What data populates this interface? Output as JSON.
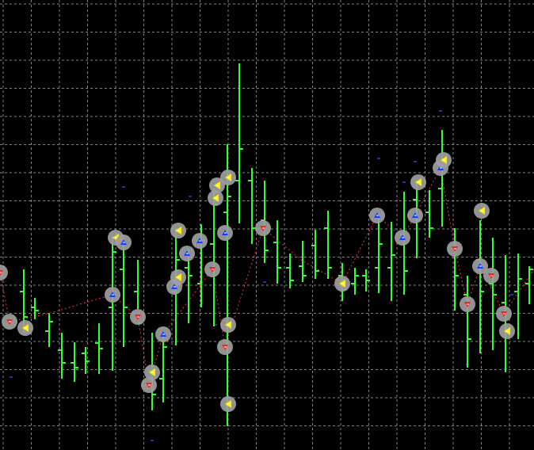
{
  "chart_data": {
    "type": "ohlc",
    "title": "",
    "xlabel": "",
    "ylabel": "",
    "grid": true,
    "ylim": [
      0,
      568
    ],
    "colors": {
      "background": "#000000",
      "grid": "#9a9a9a",
      "bar": "#33ff33",
      "arrow_up": "#1a3cff",
      "arrow_down": "#ff2020",
      "marker_yellow": "#ffee00",
      "marker_halo": "#9e9e9e",
      "dashed_line": "#ff3030",
      "dot": "#2233aa"
    },
    "bars": [
      {
        "x": 30,
        "high": 228,
        "low": 148,
        "open": 200,
        "close": 168
      },
      {
        "x": 44,
        "high": 192,
        "low": 165,
        "open": 180,
        "close": 176
      },
      {
        "x": 62,
        "high": 172,
        "low": 130,
        "open": 150,
        "close": 162
      },
      {
        "x": 78,
        "high": 148,
        "low": 90,
        "open": 126,
        "close": 110
      },
      {
        "x": 94,
        "high": 136,
        "low": 86,
        "open": 110,
        "close": 104
      },
      {
        "x": 108,
        "high": 130,
        "low": 96,
        "open": 122,
        "close": 112
      },
      {
        "x": 125,
        "high": 160,
        "low": 96,
        "open": 135,
        "close": 128
      },
      {
        "x": 142,
        "high": 270,
        "low": 100,
        "open": 180,
        "close": 250
      },
      {
        "x": 156,
        "high": 265,
        "low": 130,
        "open": 228,
        "close": 180
      },
      {
        "x": 174,
        "high": 240,
        "low": 178,
        "open": 200,
        "close": 160
      },
      {
        "x": 192,
        "high": 148,
        "low": 50,
        "open": 100,
        "close": 70
      },
      {
        "x": 206,
        "high": 148,
        "low": 60,
        "open": 90,
        "close": 130
      },
      {
        "x": 222,
        "high": 280,
        "low": 132,
        "open": 200,
        "close": 240
      },
      {
        "x": 238,
        "high": 254,
        "low": 160,
        "open": 230,
        "close": 220
      },
      {
        "x": 254,
        "high": 285,
        "low": 180,
        "open": 210,
        "close": 265
      },
      {
        "x": 270,
        "high": 330,
        "low": 156,
        "open": 260,
        "close": 310
      },
      {
        "x": 287,
        "high": 386,
        "low": 30,
        "open": 300,
        "close": 320
      },
      {
        "x": 302,
        "high": 488,
        "low": 286,
        "open": 340,
        "close": 380
      },
      {
        "x": 318,
        "high": 356,
        "low": 260,
        "open": 340,
        "close": 280
      },
      {
        "x": 334,
        "high": 340,
        "low": 236,
        "open": 290,
        "close": 252
      },
      {
        "x": 350,
        "high": 290,
        "low": 210,
        "open": 262,
        "close": 230
      },
      {
        "x": 366,
        "high": 248,
        "low": 204,
        "open": 230,
        "close": 214
      },
      {
        "x": 382,
        "high": 264,
        "low": 212,
        "open": 232,
        "close": 220
      },
      {
        "x": 398,
        "high": 278,
        "low": 216,
        "open": 258,
        "close": 226
      },
      {
        "x": 414,
        "high": 302,
        "low": 216,
        "open": 280,
        "close": 230
      },
      {
        "x": 432,
        "high": 236,
        "low": 188,
        "open": 220,
        "close": 202
      },
      {
        "x": 448,
        "high": 230,
        "low": 196,
        "open": 210,
        "close": 220
      },
      {
        "x": 462,
        "high": 228,
        "low": 200,
        "open": 220,
        "close": 214
      },
      {
        "x": 478,
        "high": 298,
        "low": 198,
        "open": 230,
        "close": 260
      },
      {
        "x": 494,
        "high": 288,
        "low": 188,
        "open": 230,
        "close": 246
      },
      {
        "x": 510,
        "high": 326,
        "low": 196,
        "open": 272,
        "close": 226
      },
      {
        "x": 526,
        "high": 340,
        "low": 242,
        "open": 316,
        "close": 290
      },
      {
        "x": 542,
        "high": 328,
        "low": 268,
        "open": 300,
        "close": 280
      },
      {
        "x": 558,
        "high": 404,
        "low": 282,
        "open": 330,
        "close": 366
      },
      {
        "x": 574,
        "high": 280,
        "low": 176,
        "open": 254,
        "close": 220
      },
      {
        "x": 590,
        "high": 220,
        "low": 104,
        "open": 196,
        "close": 140
      },
      {
        "x": 606,
        "high": 290,
        "low": 122,
        "open": 240,
        "close": 200
      },
      {
        "x": 622,
        "high": 268,
        "low": 126,
        "open": 210,
        "close": 196
      },
      {
        "x": 638,
        "high": 246,
        "low": 98,
        "open": 186,
        "close": 152
      },
      {
        "x": 654,
        "high": 248,
        "low": 140,
        "open": 200,
        "close": 216
      },
      {
        "x": 668,
        "high": 232,
        "low": 184,
        "open": 210,
        "close": 228
      }
    ],
    "markers": [
      {
        "x": 0,
        "y": 224,
        "arrow": "down"
      },
      {
        "x": 12,
        "y": 162,
        "arrow": "down"
      },
      {
        "x": 32,
        "y": 154,
        "arrow": "yellow"
      },
      {
        "x": 142,
        "y": 196,
        "arrow": "up"
      },
      {
        "x": 146,
        "y": 268,
        "arrow": "yellow"
      },
      {
        "x": 156,
        "y": 262,
        "arrow": "up"
      },
      {
        "x": 174,
        "y": 168,
        "arrow": "down"
      },
      {
        "x": 192,
        "y": 98,
        "arrow": "yellow"
      },
      {
        "x": 188,
        "y": 82,
        "arrow": "down"
      },
      {
        "x": 206,
        "y": 146,
        "arrow": "up"
      },
      {
        "x": 220,
        "y": 206,
        "arrow": "up"
      },
      {
        "x": 225,
        "y": 218,
        "arrow": "yellow"
      },
      {
        "x": 225,
        "y": 277,
        "arrow": "yellow"
      },
      {
        "x": 236,
        "y": 248,
        "arrow": "up"
      },
      {
        "x": 252,
        "y": 264,
        "arrow": "up"
      },
      {
        "x": 268,
        "y": 228,
        "arrow": "down"
      },
      {
        "x": 272,
        "y": 318,
        "arrow": "yellow"
      },
      {
        "x": 274,
        "y": 334,
        "arrow": "yellow"
      },
      {
        "x": 284,
        "y": 274,
        "arrow": "up"
      },
      {
        "x": 288,
        "y": 344,
        "arrow": "yellow"
      },
      {
        "x": 288,
        "y": 158,
        "arrow": "yellow"
      },
      {
        "x": 284,
        "y": 130,
        "arrow": "down"
      },
      {
        "x": 288,
        "y": 58,
        "arrow": "yellow"
      },
      {
        "x": 332,
        "y": 280,
        "arrow": "down"
      },
      {
        "x": 432,
        "y": 210,
        "arrow": "yellow"
      },
      {
        "x": 476,
        "y": 296,
        "arrow": "up"
      },
      {
        "x": 508,
        "y": 268,
        "arrow": "up"
      },
      {
        "x": 524,
        "y": 296,
        "arrow": "up"
      },
      {
        "x": 528,
        "y": 338,
        "arrow": "yellow"
      },
      {
        "x": 556,
        "y": 356,
        "arrow": "up"
      },
      {
        "x": 560,
        "y": 366,
        "arrow": "yellow"
      },
      {
        "x": 574,
        "y": 254,
        "arrow": "down"
      },
      {
        "x": 590,
        "y": 184,
        "arrow": "down"
      },
      {
        "x": 606,
        "y": 232,
        "arrow": "up"
      },
      {
        "x": 608,
        "y": 302,
        "arrow": "yellow"
      },
      {
        "x": 620,
        "y": 220,
        "arrow": "down"
      },
      {
        "x": 636,
        "y": 172,
        "arrow": "down"
      },
      {
        "x": 640,
        "y": 150,
        "arrow": "yellow"
      }
    ],
    "dashed_line": [
      {
        "x": 0,
        "y": 224
      },
      {
        "x": 12,
        "y": 162
      },
      {
        "x": 60,
        "y": 172
      },
      {
        "x": 142,
        "y": 196
      },
      {
        "x": 174,
        "y": 168
      },
      {
        "x": 188,
        "y": 82
      },
      {
        "x": 206,
        "y": 146
      },
      {
        "x": 268,
        "y": 228
      },
      {
        "x": 284,
        "y": 130
      },
      {
        "x": 332,
        "y": 280
      },
      {
        "x": 380,
        "y": 240
      },
      {
        "x": 432,
        "y": 210
      },
      {
        "x": 476,
        "y": 296
      },
      {
        "x": 508,
        "y": 268
      },
      {
        "x": 524,
        "y": 296
      },
      {
        "x": 556,
        "y": 356
      },
      {
        "x": 574,
        "y": 254
      },
      {
        "x": 590,
        "y": 184
      },
      {
        "x": 606,
        "y": 232
      },
      {
        "x": 636,
        "y": 172
      },
      {
        "x": 674,
        "y": 228
      }
    ],
    "dots": [
      {
        "x": 14,
        "y": 92
      },
      {
        "x": 156,
        "y": 332
      },
      {
        "x": 192,
        "y": 12
      },
      {
        "x": 222,
        "y": 216
      },
      {
        "x": 240,
        "y": 320
      },
      {
        "x": 272,
        "y": 158
      },
      {
        "x": 334,
        "y": 212
      },
      {
        "x": 350,
        "y": 232
      },
      {
        "x": 478,
        "y": 368
      },
      {
        "x": 510,
        "y": 338
      },
      {
        "x": 524,
        "y": 364
      },
      {
        "x": 556,
        "y": 428
      },
      {
        "x": 590,
        "y": 108
      },
      {
        "x": 638,
        "y": 102
      },
      {
        "x": 646,
        "y": 196
      }
    ]
  }
}
